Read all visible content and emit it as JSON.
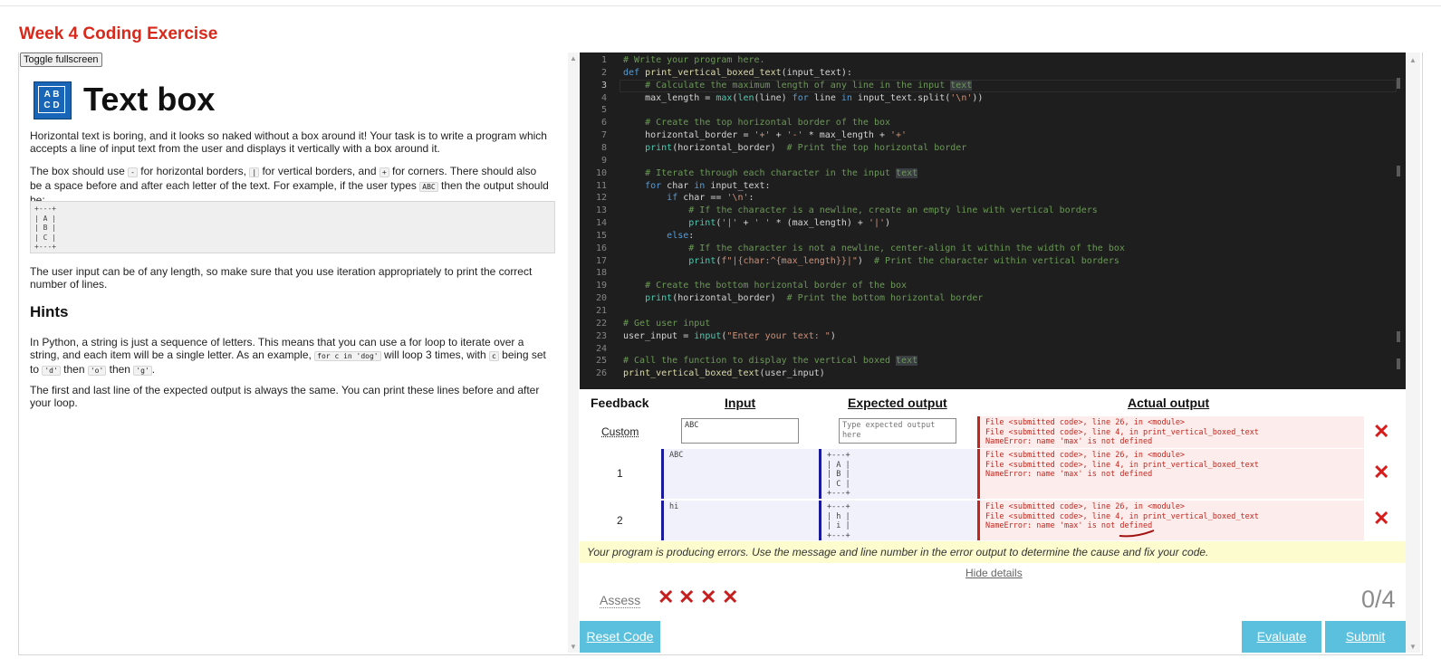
{
  "page": {
    "title": "Week 4 Coding Exercise"
  },
  "left": {
    "toggle_label": "Toggle fullscreen",
    "logo_text": "A B\nC D",
    "heading": "Text box",
    "p1": "Horizontal text is boring, and it looks so naked without a box around it! Your task is to write a program which accepts a line of input text from the user and displays it vertically with a box around it.",
    "p2_a": "The box should use ",
    "p2_code1": "-",
    "p2_b": " for horizontal borders, ",
    "p2_code2": "|",
    "p2_c": " for vertical borders, and ",
    "p2_code3": "+",
    "p2_d": " for corners. There should also be a space before and after each letter of the text. For example, if the user types ",
    "p2_code4": "ABC",
    "p2_e": " then the output should be:",
    "example_output": "+---+\n| A |\n| B |\n| C |\n+---+",
    "p3": "The user input can be of any length, so make sure that you use iteration appropriately to print the correct number of lines.",
    "hints_heading": "Hints",
    "h1_a": "In Python, a string is just a sequence of letters. This means that you can use a for loop to iterate over a string, and each item will be a single letter. As an example, ",
    "h1_code1": "for c in 'dog'",
    "h1_b": " will loop 3 times, with ",
    "h1_code2": "c",
    "h1_c": " being set to ",
    "h1_code3": "'d'",
    "h1_d": " then ",
    "h1_code4": "'o'",
    "h1_e": " then ",
    "h1_code5": "'g'",
    "h1_f": ".",
    "h2": "The first and last line of the expected output is always the same. You can print these lines before and after your loop."
  },
  "editor": {
    "active_line": 3,
    "lines": [
      "# Write your program here.",
      "def print_vertical_boxed_text(input_text):",
      "    # Calculate the maximum length of any line in the input text",
      "    max_length = max(len(line) for line in input_text.split('\\n'))",
      "",
      "    # Create the top horizontal border of the box",
      "    horizontal_border = '+' + '-' * max_length + '+'",
      "    print(horizontal_border)  # Print the top horizontal border",
      "",
      "    # Iterate through each character in the input text",
      "    for char in input_text:",
      "        if char == '\\n':",
      "            # If the character is a newline, create an empty line with vertical borders",
      "            print('|' + ' ' * (max_length) + '|')",
      "        else:",
      "            # If the character is not a newline, center-align it within the width of the box",
      "            print(f\"|{char:^{max_length}}|\")  # Print the character within vertical borders",
      "",
      "    # Create the bottom horizontal border of the box",
      "    print(horizontal_border)  # Print the bottom horizontal border",
      "",
      "# Get user input",
      "user_input = input(\"Enter your text: \")",
      "",
      "# Call the function to display the vertical boxed text",
      "print_vertical_boxed_text(user_input)"
    ]
  },
  "feedback": {
    "headers": {
      "feedback": "Feedback",
      "input": "Input",
      "expected": "Expected output",
      "actual": "Actual output"
    },
    "custom_label": "Custom",
    "custom_input_value": "ABC",
    "custom_expected_placeholder": "Type expected output here",
    "rows": [
      {
        "num": "1",
        "input": "ABC",
        "expected": "+---+\n| A |\n| B |\n| C |\n+---+"
      },
      {
        "num": "2",
        "input": "hi",
        "expected": "+---+\n| h |\n| i |\n+---+"
      }
    ],
    "error_text": "File <submitted code>, line 26, in <module>\nFile <submitted code>, line 4, in print_vertical_boxed_text\nNameError: name 'max' is not defined",
    "notice": "Your program is producing errors. Use the message and line number in the error output to determine the cause and fix your code.",
    "hide_details": "Hide details",
    "assess_label": "Assess",
    "fail_mark": "✕",
    "score": "0/4",
    "reset_label": "Reset Code",
    "evaluate_label": "Evaluate",
    "submit_label": "Submit"
  },
  "colors": {
    "title_red": "#d8291b",
    "error_red": "#c0281e",
    "button_cyan": "#5bc0de",
    "editor_bg": "#1e1e1e",
    "input_bar_blue": "#1a1a9c"
  }
}
